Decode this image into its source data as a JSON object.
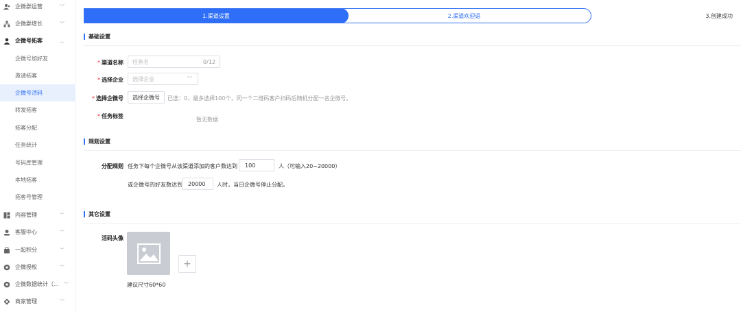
{
  "sidebar": {
    "items": [
      {
        "label": "企微群运营",
        "icon": "group-icon"
      },
      {
        "label": "企微群增长",
        "icon": "org-icon"
      },
      {
        "label": "企微号拓客",
        "icon": "person-icon"
      },
      {
        "label": "企微号加好友"
      },
      {
        "label": "邀请拓客"
      },
      {
        "label": "企微号活码"
      },
      {
        "label": "转发拓客"
      },
      {
        "label": "拓客分配"
      },
      {
        "label": "任务统计"
      },
      {
        "label": "号码库管理"
      },
      {
        "label": "本地拓客"
      },
      {
        "label": "拓客号管理"
      },
      {
        "label": "内容管理",
        "icon": "grid-icon"
      },
      {
        "label": "客服中心",
        "icon": "headset-icon"
      },
      {
        "label": "一起积分",
        "icon": "bag-icon"
      },
      {
        "label": "企微授权",
        "icon": "circle-icon"
      },
      {
        "label": "企微数据统计（...",
        "icon": "circle-icon"
      },
      {
        "label": "商家管理",
        "icon": "diamond-icon"
      }
    ]
  },
  "steps": {
    "step1": "1.渠道设置",
    "step2": "2.渠道欢迎语",
    "step3": "3.创建成功"
  },
  "basic": {
    "title": "基础设置",
    "channel_name_label": "渠道名称",
    "channel_name_placeholder": "任务名",
    "channel_name_counter": "0/12",
    "enterprise_label": "选择企业",
    "enterprise_placeholder": "选择企业",
    "wecom_label": "选择企微号",
    "wecom_button": "选择企微号",
    "wecom_hint": "已选：0，最多选择100个，同一个二维码客户扫码后随机分配一名企微号。",
    "tag_label": "任务标签",
    "tag_empty": "暂无数据"
  },
  "rules": {
    "title": "规则设置",
    "label": "分配规则",
    "line1_prefix": "任务下每个企微号从该渠道添加的客户数达到",
    "line1_value": "100",
    "line1_suffix": "人（可输入20~20000）",
    "line2_prefix": "或企微号的好友数达到",
    "line2_value": "20000",
    "line2_suffix": "人时，当日企微号停止分配。"
  },
  "other": {
    "title": "其它设置",
    "avatar_label": "活码头像",
    "avatar_hint": "建议尺寸60*60",
    "add_symbol": "+"
  },
  "colors": {
    "accent": "#2f6ef6",
    "active_bg": "#e8f0fe",
    "required": "#f5222d"
  }
}
